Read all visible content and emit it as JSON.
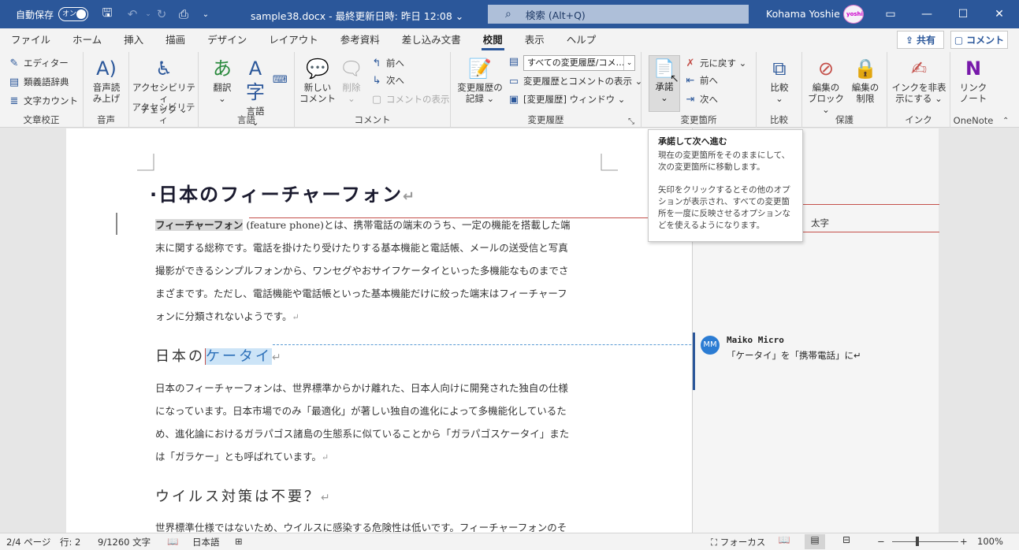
{
  "titlebar": {
    "autosave_label": "自動保存",
    "autosave_state": "オン",
    "filename": "sample38.docx - 最終更新日時: 昨日 12:08 ⌄",
    "search_placeholder": "検索 (Alt+Q)",
    "user_name": "Kohama Yoshie",
    "avatar_text": "yoshie"
  },
  "tabs": [
    "ファイル",
    "ホーム",
    "挿入",
    "描画",
    "デザイン",
    "レイアウト",
    "参考資料",
    "差し込み文書",
    "校閲",
    "表示",
    "ヘルプ"
  ],
  "active_tab": "校閲",
  "share_label": "共有",
  "comment_label": "コメント",
  "ribbon": {
    "proofing": {
      "label": "文章校正",
      "editor": "エディター",
      "thesaurus": "類義語辞典",
      "wordcount": "文字カウント"
    },
    "speech": {
      "label": "音声",
      "readaloud_line1": "音声読",
      "readaloud_line2": "み上げ"
    },
    "accessibility": {
      "label": "アクセシビリティ",
      "check_line1": "アクセシビリティ",
      "check_line2": "チェック ⌄"
    },
    "language": {
      "label": "言語",
      "translate_line1": "翻訳",
      "translate_line2": "⌄",
      "lang_line1": "言語",
      "lang_line2": "⌄"
    },
    "comments": {
      "label": "コメント",
      "new_line1": "新しい",
      "new_line2": "コメント",
      "delete_line1": "削除",
      "delete_line2": "⌄",
      "prev": "前へ",
      "next": "次へ",
      "show": "コメントの表示"
    },
    "tracking": {
      "label": "変更履歴",
      "track_line1": "変更履歴の",
      "track_line2": "記録 ⌄",
      "select_value": "すべての変更履歴/コメ…",
      "show_markup": "変更履歴とコメントの表示 ⌄",
      "pane": "[変更履歴] ウィンドウ ⌄"
    },
    "changes": {
      "label": "変更箇所",
      "accept_line1": "承諾",
      "accept_line2": "⌄",
      "reject": "元に戻す ⌄",
      "prev": "前へ",
      "next": "次へ"
    },
    "compare": {
      "label": "比較",
      "compare_line1": "比較",
      "compare_line2": "⌄"
    },
    "protect": {
      "label": "保護",
      "block_line1": "編集の",
      "block_line2": "ブロック ⌄",
      "restrict_line1": "編集の",
      "restrict_line2": "制限"
    },
    "ink": {
      "label": "インク",
      "hide_line1": "インクを非表",
      "hide_line2": "示にする ⌄"
    },
    "onenote": {
      "label": "OneNote",
      "link_line1": "リンク",
      "link_line2": "ノート"
    }
  },
  "document": {
    "title": "日本のフィーチャーフォン",
    "para1_highlight": "フィーチャーフォン",
    "para1_lines": [
      " (feature phone)とは、携帯電話の端末のうち、一定の機能を搭載した端",
      "末に関する総称です。電話を掛けたり受けたりする基本機能と電話帳、メールの送受信と写真",
      "撮影ができるシンプルフォンから、ワンセグやおサイフケータイといった多機能なものまでさ",
      "まざまです。ただし、電話機能や電話帳といった基本機能だけに絞った端末はフィーチャーフ",
      "ォンに分類されないようです。"
    ],
    "h2a_prefix": "日本の",
    "h2a_selected": "ケータイ",
    "para2_lines": [
      "日本のフィーチャーフォンは、世界標準からかけ離れた、日本人向けに開発された独自の仕様",
      "になっています。日本市場でのみ「最適化」が著しい独自の進化によって多機能化しているた",
      "め、進化論におけるガラパゴス諸島の生態系に似ていることから「ガラパゴスケータイ」また",
      "は「ガラケー」とも呼ばれています。"
    ],
    "h2b": "ウイルス対策は不要？",
    "para3_line": "世界標準仕様ではないため、ウイルスに感染する危険性は低いです。フィーチャーフォンのそ",
    "para_mark": "↵"
  },
  "markup": {
    "format_label": "太字",
    "comment_initials": "MM",
    "comment_author": "Maiko Micro",
    "comment_text": "「ケータイ」を「携帯電話」に↵"
  },
  "tooltip": {
    "title": "承諾して次へ進む",
    "para1": "現在の変更箇所をそのままにして、次の変更箇所に移動します。",
    "para2": "矢印をクリックするとその他のオプションが表示され、すべての変更箇所を一度に反映させるオプションなどを使えるようになります。"
  },
  "status": {
    "page": "2/4 ページ",
    "line": "行: 2",
    "chars": "9/1260 文字",
    "language": "日本語",
    "focus": "フォーカス",
    "zoom": "100%",
    "zoom_minus": "−",
    "zoom_plus": "+"
  },
  "colors": {
    "accent": "#2b579a",
    "revision": "#c4504a",
    "comment_avatar": "#2b7cd3"
  }
}
